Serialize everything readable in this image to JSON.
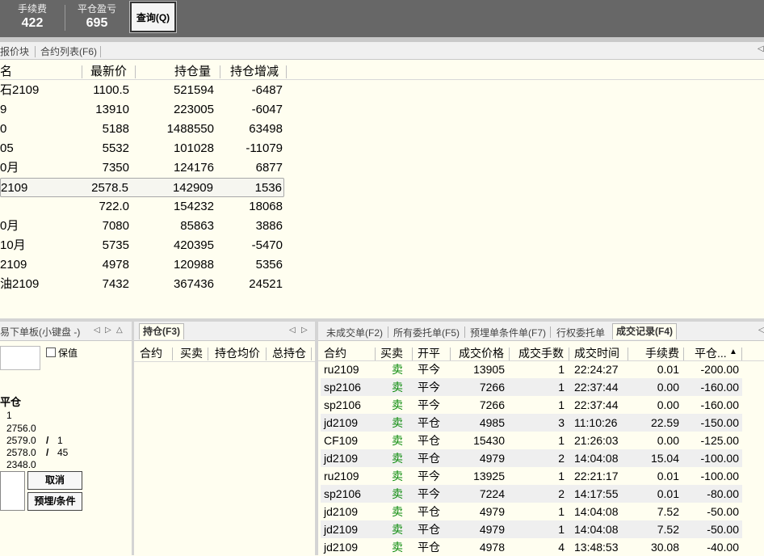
{
  "topbar": {
    "stats": [
      {
        "label": "手续费",
        "value": "422"
      },
      {
        "label": "平仓盈亏",
        "value": "695"
      }
    ],
    "query_button": "查询(Q)"
  },
  "quote_panel": {
    "tabs": [
      "报价块",
      "合约列表(F6)"
    ],
    "headers": [
      "名",
      "最新价",
      "持仓量",
      "持仓增减"
    ],
    "rows": [
      {
        "name": "石2109",
        "price": "1100.5",
        "oi": "521594",
        "chg": "-6487"
      },
      {
        "name": "9",
        "price": "13910",
        "oi": "223005",
        "chg": "-6047"
      },
      {
        "name": "0",
        "price": "5188",
        "oi": "1488550",
        "chg": "63498"
      },
      {
        "name": "05",
        "price": "5532",
        "oi": "101028",
        "chg": "-11079"
      },
      {
        "name": "0月",
        "price": "7350",
        "oi": "124176",
        "chg": "6877"
      },
      {
        "name": "2109",
        "price": "2578.5",
        "oi": "142909",
        "chg": "1536"
      },
      {
        "name": "",
        "price": "722.0",
        "oi": "154232",
        "chg": "18068"
      },
      {
        "name": "0月",
        "price": "7080",
        "oi": "85863",
        "chg": "3886"
      },
      {
        "name": "10月",
        "price": "5735",
        "oi": "420395",
        "chg": "-5470"
      },
      {
        "name": "2109",
        "price": "4978",
        "oi": "120988",
        "chg": "5356"
      },
      {
        "name": "油2109",
        "price": "7432",
        "oi": "367436",
        "chg": "24521"
      }
    ]
  },
  "order_panel": {
    "tab": "易下单板(小键盘 -)",
    "hedge_label": "保值",
    "close_label": "平仓",
    "qty": "1",
    "levels": [
      {
        "price": "2756.0",
        "vol": ""
      },
      {
        "price": "2579.0",
        "vol": "1"
      },
      {
        "price": "2578.0",
        "vol": "45"
      },
      {
        "price": "2348.0",
        "vol": ""
      }
    ],
    "slash": "/",
    "cancel_button": "取消",
    "preset_button": "预埋/条件"
  },
  "position_panel": {
    "tab": "持仓(F3)",
    "headers": [
      "合约",
      "买卖",
      "持仓均价",
      "总持仓"
    ]
  },
  "deals_panel": {
    "tabs": [
      "未成交单(F2)",
      "所有委托单(F5)",
      "预埋单条件单(F7)",
      "行权委托单",
      "成交记录(F4)"
    ],
    "headers": [
      "合约",
      "买卖",
      "开平",
      "成交价格",
      "成交手数",
      "成交时间",
      "手续费",
      "平仓..."
    ],
    "sort_indicator": "▲",
    "rows": [
      {
        "code": "ru2109",
        "side": "卖",
        "oc": "平今",
        "price": "13905",
        "qty": "1",
        "time": "22:24:27",
        "fee": "0.01",
        "pnl": "-200.00"
      },
      {
        "code": "sp2106",
        "side": "卖",
        "oc": "平今",
        "price": "7266",
        "qty": "1",
        "time": "22:37:44",
        "fee": "0.00",
        "pnl": "-160.00"
      },
      {
        "code": "sp2106",
        "side": "卖",
        "oc": "平今",
        "price": "7266",
        "qty": "1",
        "time": "22:37:44",
        "fee": "0.00",
        "pnl": "-160.00"
      },
      {
        "code": "jd2109",
        "side": "卖",
        "oc": "平仓",
        "price": "4985",
        "qty": "3",
        "time": "11:10:26",
        "fee": "22.59",
        "pnl": "-150.00"
      },
      {
        "code": "CF109",
        "side": "卖",
        "oc": "平仓",
        "price": "15430",
        "qty": "1",
        "time": "21:26:03",
        "fee": "0.00",
        "pnl": "-125.00"
      },
      {
        "code": "jd2109",
        "side": "卖",
        "oc": "平仓",
        "price": "4979",
        "qty": "2",
        "time": "14:04:08",
        "fee": "15.04",
        "pnl": "-100.00"
      },
      {
        "code": "ru2109",
        "side": "卖",
        "oc": "平今",
        "price": "13925",
        "qty": "1",
        "time": "22:21:17",
        "fee": "0.01",
        "pnl": "-100.00"
      },
      {
        "code": "sp2106",
        "side": "卖",
        "oc": "平今",
        "price": "7224",
        "qty": "2",
        "time": "14:17:55",
        "fee": "0.01",
        "pnl": "-80.00"
      },
      {
        "code": "jd2109",
        "side": "卖",
        "oc": "平仓",
        "price": "4979",
        "qty": "1",
        "time": "14:04:08",
        "fee": "7.52",
        "pnl": "-50.00"
      },
      {
        "code": "jd2109",
        "side": "卖",
        "oc": "平仓",
        "price": "4979",
        "qty": "1",
        "time": "14:04:08",
        "fee": "7.52",
        "pnl": "-50.00"
      },
      {
        "code": "jd2109",
        "side": "卖",
        "oc": "平仓",
        "price": "4978",
        "qty": "4",
        "time": "13:48:53",
        "fee": "30.08",
        "pnl": "-40.00"
      }
    ]
  }
}
